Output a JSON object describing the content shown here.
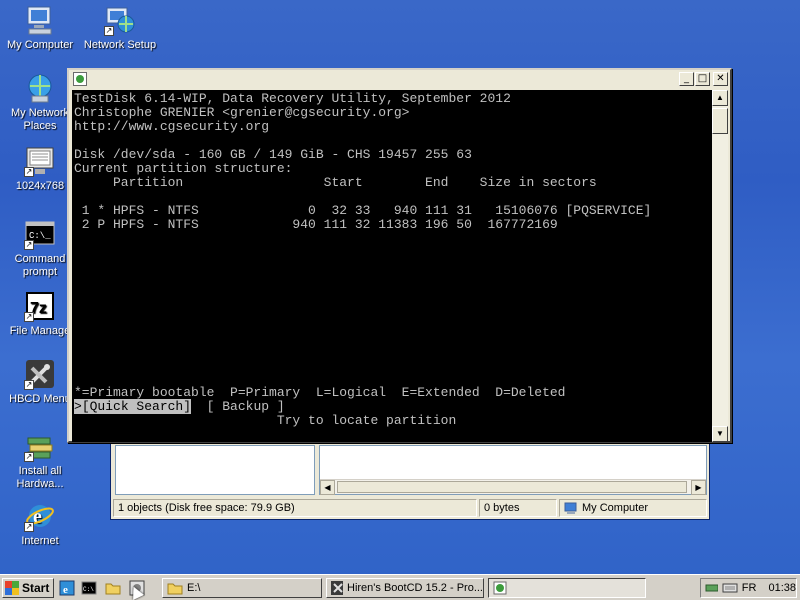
{
  "desktop": {
    "icons": [
      {
        "label": "My Computer",
        "icon": "my-computer-icon"
      },
      {
        "label": "Network Setup",
        "icon": "network-setup-icon"
      },
      {
        "label": "My Network Places",
        "line1": "My Network",
        "line2": "Places",
        "icon": "network-places-icon"
      },
      {
        "label": "1024x768",
        "icon": "monitor-icon"
      },
      {
        "label": "Command prompt",
        "line1": "Command",
        "line2": "prompt",
        "icon": "command-prompt-icon"
      },
      {
        "label": "File Manage",
        "icon": "7zip-icon"
      },
      {
        "label": "HBCD Menu",
        "icon": "tools-icon"
      },
      {
        "label": "Install all Hardwa...",
        "line1": "Install all",
        "line2": "Hardwa...",
        "icon": "hardware-icon"
      },
      {
        "label": "Internet",
        "icon": "internet-explorer-icon"
      }
    ]
  },
  "console": {
    "lines": [
      "TestDisk 6.14-WIP, Data Recovery Utility, September 2012",
      "Christophe GRENIER <grenier@cgsecurity.org>",
      "http://www.cgsecurity.org",
      "",
      "Disk /dev/sda - 160 GB / 149 GiB - CHS 19457 255 63",
      "Current partition structure:",
      "     Partition                  Start        End    Size in sectors",
      "",
      " 1 * HPFS - NTFS              0  32 33   940 111 31   15106076 [PQSERVICE]",
      " 2 P HPFS - NTFS            940 111 32 11383 196 50  167772169",
      "",
      "",
      "",
      "",
      "",
      "",
      "",
      "",
      "",
      "",
      "",
      "*=Primary bootable  P=Primary  L=Logical  E=Extended  D=Deleted"
    ],
    "menu_prefix": ">",
    "menu_selected": "[Quick Search]",
    "menu_other": "  [ Backup ]",
    "hint": "                          Try to locate partition",
    "minimize": "_",
    "maximize": "□",
    "close": "✕"
  },
  "explorer": {
    "status_objects": "1 objects (Disk free space: 79.9 GB)",
    "status_size": "0 bytes",
    "status_location": "My Computer"
  },
  "taskbar": {
    "start_label": "Start",
    "tasks": [
      {
        "label": "E:\\",
        "icon": "folder-icon"
      },
      {
        "label": "Hiren's BootCD 15.2 - Pro...",
        "icon": "tools-icon"
      },
      {
        "label": "",
        "icon": "testdisk-icon"
      }
    ],
    "tray": {
      "language": "FR",
      "time": "01:38"
    }
  },
  "colors": {
    "desktop": "#3a68c8",
    "console_bg": "#000000",
    "console_fg": "#c0c0c0",
    "chrome": "#d4d0c8"
  }
}
